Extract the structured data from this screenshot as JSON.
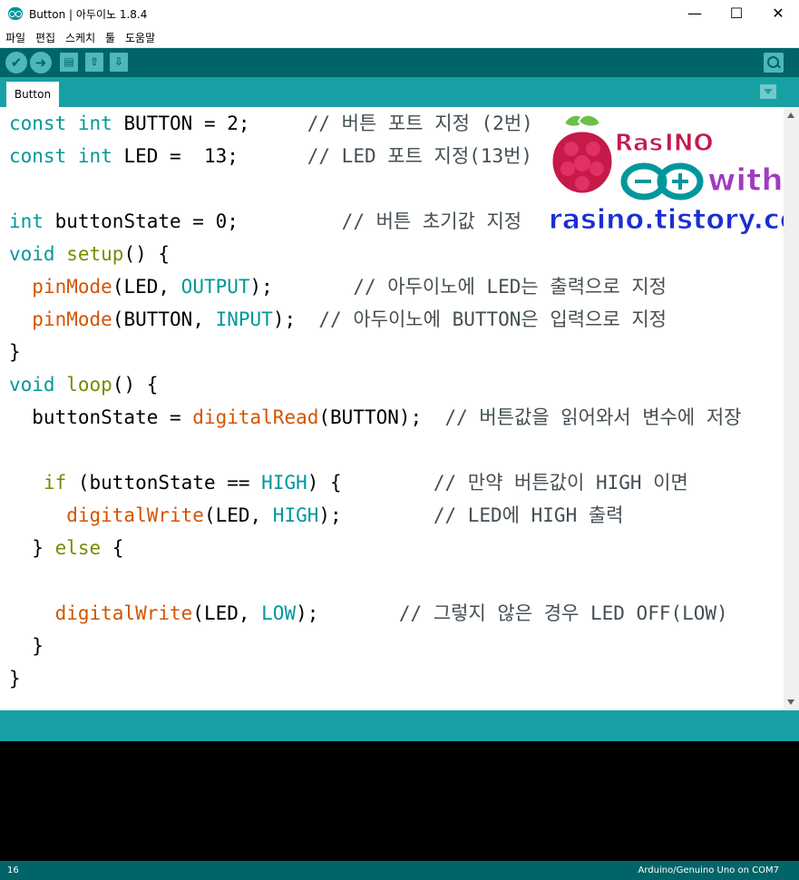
{
  "window": {
    "title": "Button | 아두이노 1.8.4",
    "controls": {
      "minimize": "—",
      "maximize": "☐",
      "close": "✕"
    }
  },
  "menu": [
    "파일",
    "편집",
    "스케치",
    "툴",
    "도움말"
  ],
  "toolbar": {
    "verify_icon": "✔",
    "upload_icon": "➜",
    "new_icon": "▤",
    "open_icon": "⇧",
    "save_icon": "⇩"
  },
  "tabs": [
    {
      "label": "Button"
    }
  ],
  "code": {
    "lines": [
      [
        [
          "kw",
          "const"
        ],
        [
          "p",
          " "
        ],
        [
          "kw",
          "int"
        ],
        [
          "p",
          " BUTTON = 2;     "
        ],
        [
          "cm",
          "// 버튼 포트 지정 (2번)"
        ]
      ],
      [
        [
          "kw",
          "const"
        ],
        [
          "p",
          " "
        ],
        [
          "kw",
          "int"
        ],
        [
          "p",
          " LED =  13;      "
        ],
        [
          "cm",
          "// LED 포트 지정(13번)"
        ]
      ],
      [],
      [
        [
          "kw",
          "int"
        ],
        [
          "p",
          " buttonState = 0;         "
        ],
        [
          "cm",
          "// 버튼 초기값 지정"
        ]
      ],
      [
        [
          "kw",
          "void"
        ],
        [
          "p",
          " "
        ],
        [
          "ctl",
          "setup"
        ],
        [
          "p",
          "() {"
        ]
      ],
      [
        [
          "p",
          "  "
        ],
        [
          "fn",
          "pinMode"
        ],
        [
          "p",
          "(LED, "
        ],
        [
          "kw",
          "OUTPUT"
        ],
        [
          "p",
          ");       "
        ],
        [
          "cm",
          "// 아두이노에 LED는 출력으로 지정"
        ]
      ],
      [
        [
          "p",
          "  "
        ],
        [
          "fn",
          "pinMode"
        ],
        [
          "p",
          "(BUTTON, "
        ],
        [
          "kw",
          "INPUT"
        ],
        [
          "p",
          ");  "
        ],
        [
          "cm",
          "// 아두이노에 BUTTON은 입력으로 지정"
        ]
      ],
      [
        [
          "p",
          "}"
        ]
      ],
      [
        [
          "kw",
          "void"
        ],
        [
          "p",
          " "
        ],
        [
          "ctl",
          "loop"
        ],
        [
          "p",
          "() {"
        ]
      ],
      [
        [
          "p",
          "  buttonState = "
        ],
        [
          "fn",
          "digitalRead"
        ],
        [
          "p",
          "(BUTTON);  "
        ],
        [
          "cm",
          "// 버튼값을 읽어와서 변수에 저장"
        ]
      ],
      [],
      [
        [
          "p",
          "   "
        ],
        [
          "ctl",
          "if"
        ],
        [
          "p",
          " (buttonState == "
        ],
        [
          "kw",
          "HIGH"
        ],
        [
          "p",
          ") {        "
        ],
        [
          "cm",
          "// 만약 버튼값이 HIGH 이면"
        ]
      ],
      [
        [
          "p",
          "     "
        ],
        [
          "fn",
          "digitalWrite"
        ],
        [
          "p",
          "(LED, "
        ],
        [
          "kw",
          "HIGH"
        ],
        [
          "p",
          ");        "
        ],
        [
          "cm",
          "// LED에 HIGH 출력"
        ]
      ],
      [
        [
          "p",
          "  } "
        ],
        [
          "ctl",
          "else"
        ],
        [
          "p",
          " {"
        ]
      ],
      [],
      [
        [
          "p",
          "    "
        ],
        [
          "fn",
          "digitalWrite"
        ],
        [
          "p",
          "(LED, "
        ],
        [
          "kw",
          "LOW"
        ],
        [
          "p",
          ");       "
        ],
        [
          "cm",
          "// 그렇지 않은 경우 LED OFF(LOW)"
        ]
      ],
      [
        [
          "p",
          "  }"
        ]
      ],
      [
        [
          "p",
          "}"
        ]
      ]
    ]
  },
  "logo": {
    "brand_prefix": "Ras",
    "brand_suffix": "INO",
    "tagline": "with",
    "site": "rasino.tistory.com"
  },
  "colors": {
    "toolbar": "#006468",
    "tabbar": "#17a1a5",
    "keyword": "#00979c",
    "function": "#d35400",
    "control": "#728e00",
    "comment": "#434f54"
  },
  "footer": {
    "line_number": "16",
    "board": "Arduino/Genuino Uno on COM7"
  }
}
